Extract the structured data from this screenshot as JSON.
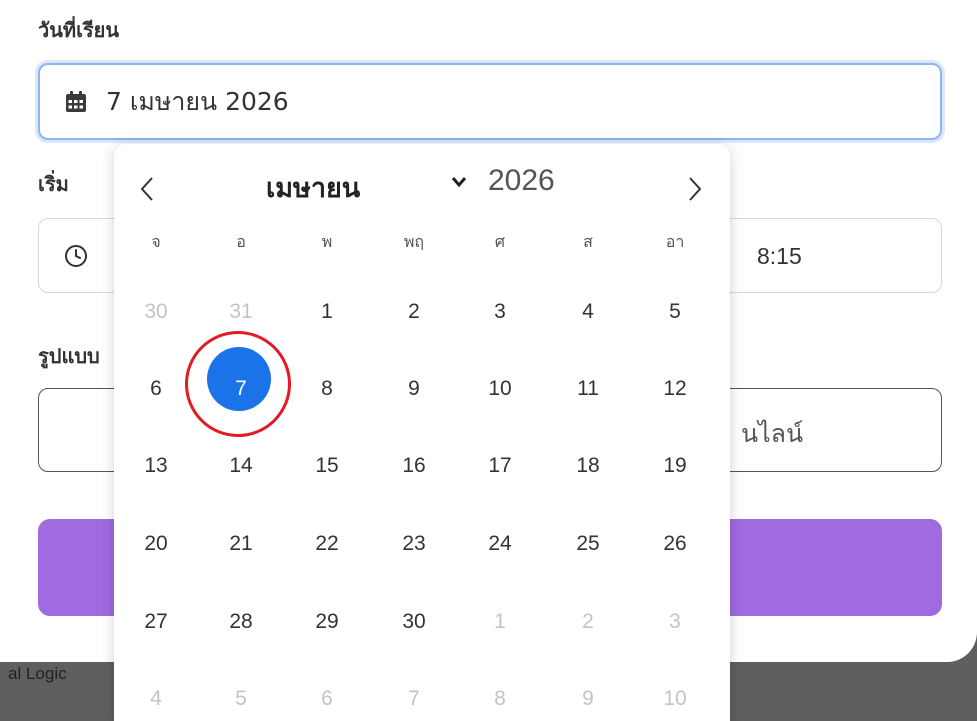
{
  "form": {
    "date_label": "วันที่เรียน",
    "date_value": "7 เมษายน 2026",
    "start_label": "เริ่ม",
    "time_value_visible": "8:15",
    "format_label_visible": "รูปแบบ",
    "format_value_visible": "นไลน์",
    "footer_text_visible": "al Logic"
  },
  "calendar": {
    "month": "เมษายน",
    "year": "2026",
    "weekdays": [
      "จ",
      "อ",
      "พ",
      "พฤ",
      "ศ",
      "ส",
      "อา"
    ],
    "weeks": [
      [
        {
          "d": "30",
          "m": true
        },
        {
          "d": "31",
          "m": true
        },
        {
          "d": "1"
        },
        {
          "d": "2"
        },
        {
          "d": "3"
        },
        {
          "d": "4"
        },
        {
          "d": "5"
        }
      ],
      [
        {
          "d": "6"
        },
        {
          "d": "7",
          "selected": true
        },
        {
          "d": "8"
        },
        {
          "d": "9"
        },
        {
          "d": "10"
        },
        {
          "d": "11"
        },
        {
          "d": "12"
        }
      ],
      [
        {
          "d": "13"
        },
        {
          "d": "14"
        },
        {
          "d": "15"
        },
        {
          "d": "16"
        },
        {
          "d": "17"
        },
        {
          "d": "18"
        },
        {
          "d": "19"
        }
      ],
      [
        {
          "d": "20"
        },
        {
          "d": "21"
        },
        {
          "d": "22"
        },
        {
          "d": "23"
        },
        {
          "d": "24"
        },
        {
          "d": "25"
        },
        {
          "d": "26"
        }
      ],
      [
        {
          "d": "27"
        },
        {
          "d": "28"
        },
        {
          "d": "29"
        },
        {
          "d": "30"
        },
        {
          "d": "1",
          "m": true
        },
        {
          "d": "2",
          "m": true
        },
        {
          "d": "3",
          "m": true
        }
      ],
      [
        {
          "d": "4",
          "m": true
        },
        {
          "d": "5",
          "m": true
        },
        {
          "d": "6",
          "m": true
        },
        {
          "d": "7",
          "m": true
        },
        {
          "d": "8",
          "m": true
        },
        {
          "d": "9",
          "m": true
        },
        {
          "d": "10",
          "m": true
        }
      ]
    ],
    "selected_color": "#1a73e8",
    "highlight_color": "#e01b24"
  },
  "colors": {
    "focus_border": "#8fb4f2",
    "submit": "#a06ae0"
  },
  "icons": {
    "date_field": "calendar-icon",
    "time_field": "clock-icon",
    "prev": "chevron-left-icon",
    "next": "chevron-right-icon",
    "month_dropdown": "chevron-down-icon"
  }
}
